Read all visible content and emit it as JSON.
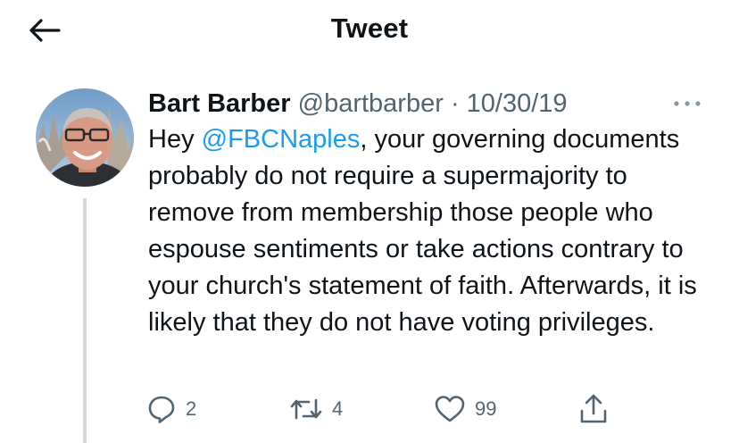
{
  "header": {
    "title": "Tweet",
    "back_icon": "arrow-left-icon"
  },
  "tweet": {
    "author": {
      "display_name": "Bart Barber",
      "handle": "@bartbarber",
      "avatar_icon": "profile-photo"
    },
    "separator": "·",
    "date": "10/30/19",
    "text": {
      "prefix": "Hey ",
      "mention": "@FBCNaples",
      "rest": ", your governing documents probably do not require a supermajority to remove from membership those people who espouse sentiments or take actions contrary to your church's statement of faith. Afterwards, it is likely that they do not have voting privileges."
    },
    "actions": {
      "reply_count": "2",
      "retweet_count": "4",
      "like_count": "99"
    },
    "colors": {
      "mention": "#1d9bf0",
      "secondary_text": "#536471",
      "primary_text": "#0f1419"
    }
  }
}
